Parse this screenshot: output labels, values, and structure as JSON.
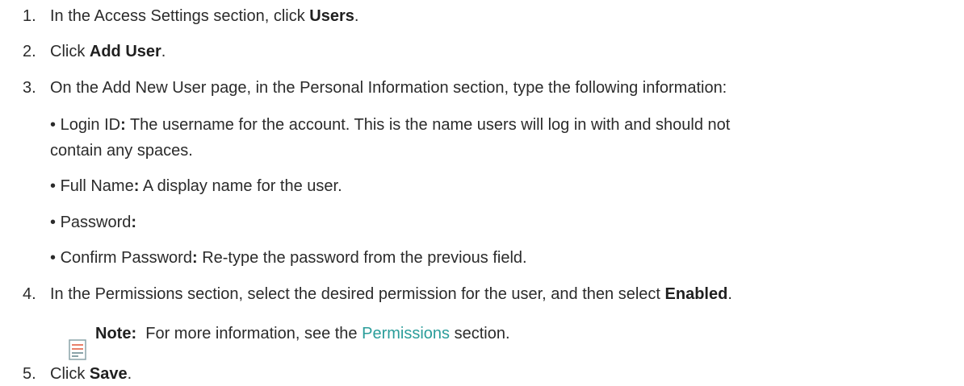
{
  "steps": [
    {
      "num": "1.",
      "pre": "In the Access Settings section, click ",
      "bold": "Users",
      "post": "."
    },
    {
      "num": "2.",
      "pre": "Click ",
      "bold": "Add User",
      "post": "."
    },
    {
      "num": "3.",
      "text": "On the Add New User page, in the Personal Information section, type the following information:"
    },
    {
      "num": "4.",
      "pre": "In the Permissions section, select the desired permission for the user, and then select ",
      "bold": "Enabled",
      "post": "."
    },
    {
      "num": "5.",
      "pre": "Click ",
      "bold": "Save",
      "post": "."
    }
  ],
  "fields": [
    {
      "bullet": "•",
      "name": "Login ID",
      "colon": ":",
      "desc_line1": " The username for the account. This is the name users will log in with and should not",
      "desc_line2": "contain any spaces."
    },
    {
      "bullet": "•",
      "name": "Full Name",
      "colon": ":",
      "desc": " A display name for the user."
    },
    {
      "bullet": "•",
      "name": "Password",
      "colon": ":",
      "desc": ""
    },
    {
      "bullet": "•",
      "name": "Confirm Password",
      "colon": ":",
      "desc": " Re-type the password from the previous field."
    }
  ],
  "note": {
    "label": "Note:",
    "pre": "  For more information, see the ",
    "link": "Permissions",
    "post": " section.",
    "icon": "note-icon",
    "icon_color": "#e8806a",
    "icon_lines_color": "#8aa3a8"
  }
}
